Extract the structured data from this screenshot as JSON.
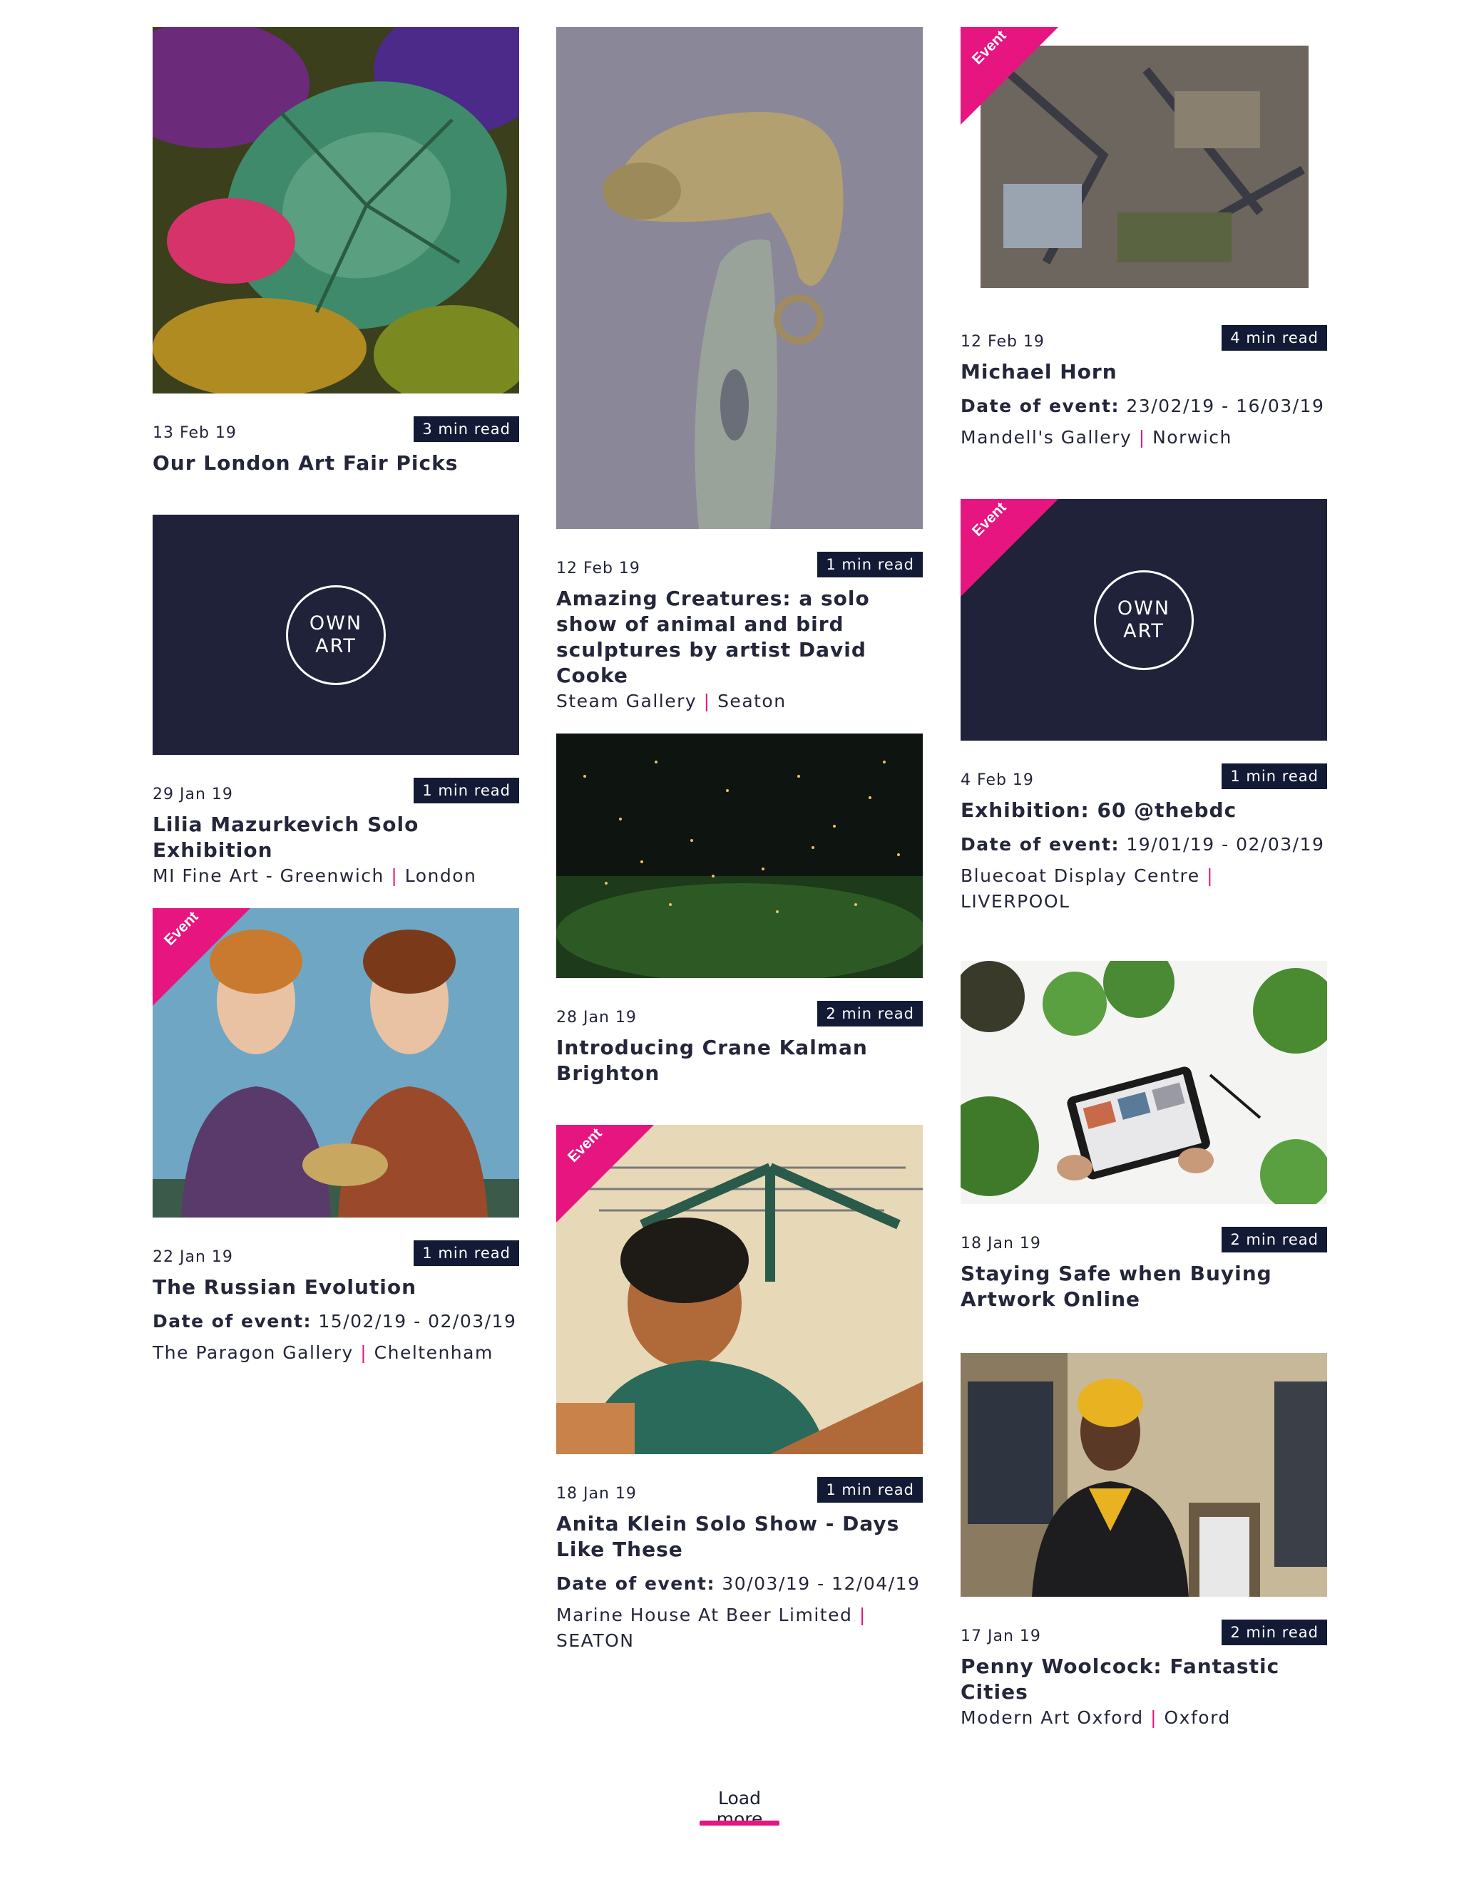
{
  "labels": {
    "event": "Event",
    "date_of_event": "Date of event:",
    "load_more": "Load more"
  },
  "ownart_logo": [
    "OWN",
    "ART"
  ],
  "colors": {
    "accent": "#e6157f",
    "navy": "#131a36",
    "placeholder_bg": "#20223a"
  },
  "cards": [
    {
      "date": "13 Feb 19",
      "read": "3 min read",
      "title": "Our London Art Fair Picks",
      "image": "tropical-leaves-artwork"
    },
    {
      "date": "29 Jan 19",
      "read": "1 min read",
      "title": "Lilia Mazurkevich Solo Exhibition",
      "venue": "MI Fine Art - Greenwich",
      "city": "London",
      "image": "own-art-logo"
    },
    {
      "date": "22 Jan 19",
      "read": "1 min read",
      "title": "The Russian Evolution",
      "event_dates": "15/02/19 - 02/03/19",
      "venue": "The Paragon Gallery",
      "city": "Cheltenham",
      "image": "two-women-painting",
      "event": true
    },
    {
      "date": "12 Feb 19",
      "read": "1 min read",
      "title": "Amazing Creatures: a solo show of animal and bird sculptures by artist David Cooke",
      "venue": "Steam Gallery",
      "city": "Seaton",
      "image": "chameleon-sculpture"
    },
    {
      "date": "28 Jan 19",
      "read": "2 min read",
      "title": "Introducing Crane Kalman Brighton",
      "image": "firefly-forest-photo"
    },
    {
      "date": "18 Jan 19",
      "read": "1 min read",
      "title": "Anita Klein Solo Show - Days Like These",
      "event_dates": "30/03/19 - 12/04/19",
      "venue": "Marine House At Beer Limited",
      "city": "SEATON",
      "image": "washing-line-painting",
      "event": true
    },
    {
      "date": "12 Feb 19",
      "read": "4 min read",
      "title": "Michael Horn",
      "event_dates": "23/02/19 - 16/03/19",
      "venue": "Mandell's Gallery",
      "city": "Norwich",
      "image": "abstract-painting",
      "event": true
    },
    {
      "date": "4 Feb 19",
      "read": "1 min read",
      "title": "Exhibition: 60 @thebdc",
      "event_dates": "19/01/19 - 02/03/19",
      "venue": "Bluecoat Display Centre",
      "city": "LIVERPOOL",
      "image": "own-art-logo",
      "event": true
    },
    {
      "date": "18 Jan 19",
      "read": "2 min read",
      "title": "Staying Safe when Buying Artwork Online",
      "image": "tablet-plants-photo"
    },
    {
      "date": "17 Jan 19",
      "read": "2 min read",
      "title": "Penny Woolcock: Fantastic Cities",
      "venue": "Modern Art Oxford",
      "city": "Oxford",
      "image": "man-yellow-beanie-photo"
    }
  ]
}
